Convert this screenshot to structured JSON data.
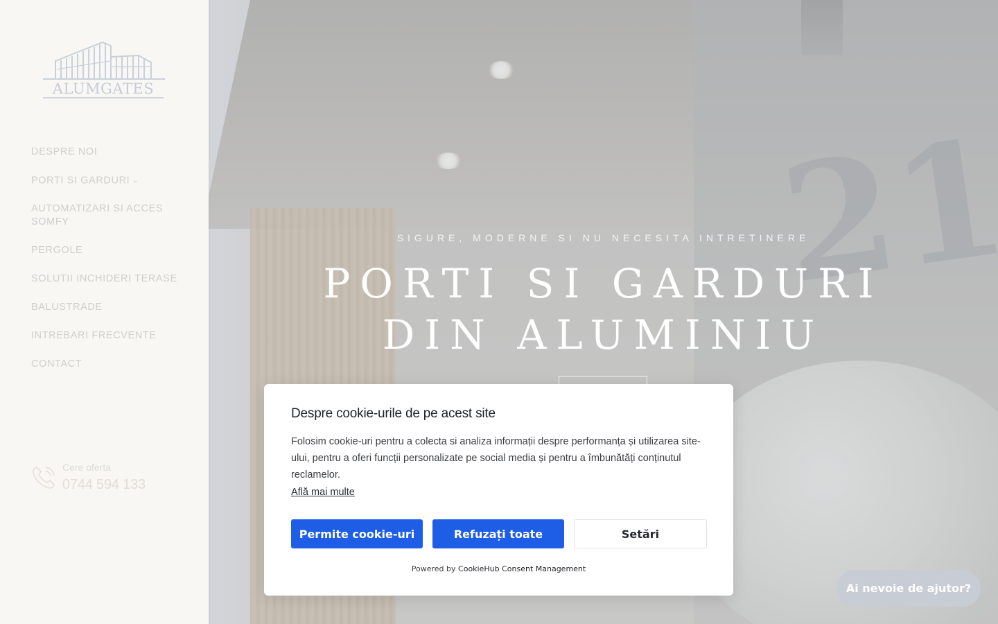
{
  "brand": {
    "logo_text": "ALUMGATES"
  },
  "nav": {
    "items": [
      {
        "label": "DESPRE NOI",
        "has_dropdown": false
      },
      {
        "label": "PORTI SI GARDURI",
        "has_dropdown": true
      },
      {
        "label": "AUTOMATIZARI SI ACCES SOMFY",
        "has_dropdown": false
      },
      {
        "label": "PERGOLE",
        "has_dropdown": false
      },
      {
        "label": "SOLUTII INCHIDERI TERASE",
        "has_dropdown": false
      },
      {
        "label": "BALUSTRADE",
        "has_dropdown": false
      },
      {
        "label": "INTREBARI FRECVENTE",
        "has_dropdown": false
      },
      {
        "label": "CONTACT",
        "has_dropdown": false
      }
    ],
    "dropdown_icon": "chevron-down-icon"
  },
  "contact": {
    "label": "Cere oferta",
    "phone": "0744 594 133",
    "icon": "phone-icon"
  },
  "hero": {
    "tagline": "SIGURE, MODERNE SI NU NECESITA INTRETINERE",
    "title_line1": "PORTI SI GARDURI",
    "title_line2": "DIN ALUMINIU",
    "house_number": "21"
  },
  "cookie": {
    "title": "Despre cookie-urile de pe acest site",
    "text": "Folosim cookie-uri pentru a colecta si analiza informații despre performanța și utilizarea site-ului, pentru a oferi funcții personalizate pe social media și pentru a îmbunătăți conținutul reclamelor.",
    "learn_more": "Află mai multe",
    "allow_label": "Permite cookie-uri",
    "refuse_label": "Refuzați toate",
    "settings_label": "Setări",
    "powered_prefix": "Powered by",
    "powered_brand": "CookieHub Consent Management"
  },
  "help": {
    "label": "Ai nevoie de ajutor?"
  },
  "colors": {
    "primary_button": "#1e5ee6",
    "sidebar_bg": "#f8f7f4",
    "help_button_bg": "#c7ccd5"
  }
}
